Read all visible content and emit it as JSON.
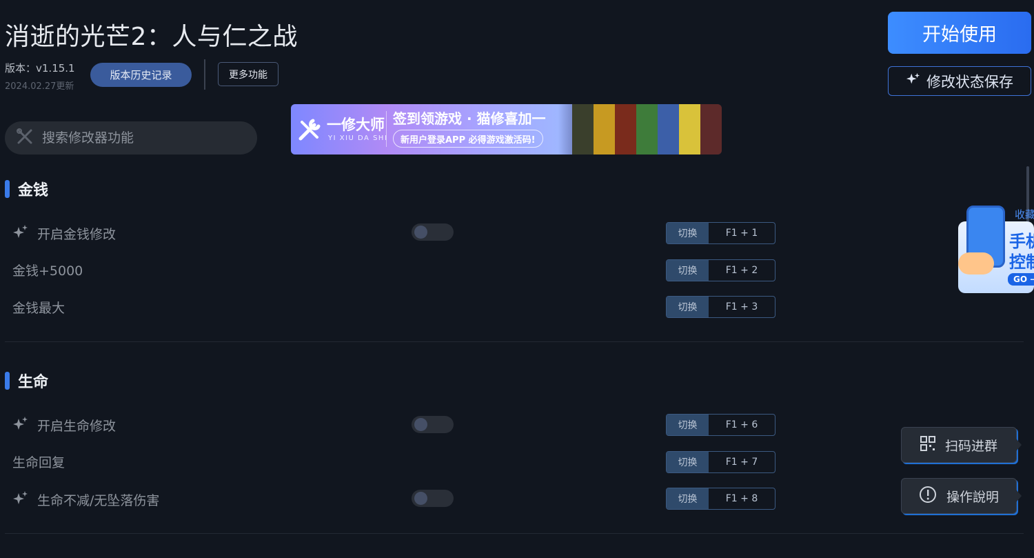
{
  "header": {
    "title": "消逝的光芒2：人与仁之战",
    "version": "版本：v1.15.1",
    "update_date": "2024.02.27更新",
    "history_button": "版本历史记录",
    "more_button": "更多功能"
  },
  "actions": {
    "start_button": "开始使用",
    "save_state_button": "修改状态保存"
  },
  "search": {
    "placeholder": "搜索修改器功能"
  },
  "banner": {
    "brand": "一修大师",
    "brand_pinyin": "YI XIU DA SHI",
    "headline": "签到领游戏 · 猫修喜加一",
    "subline": "新用户登录APP  必得游戏激活码!"
  },
  "sections": [
    {
      "title": "金钱",
      "rows": [
        {
          "label": "开启金钱修改",
          "has_toggle": true,
          "toggle_on": false,
          "action": "切换",
          "hotkey": "F1 + 1"
        },
        {
          "label": "金钱+5000",
          "has_toggle": false,
          "action": "切换",
          "hotkey": "F1 + 2"
        },
        {
          "label": "金钱最大",
          "has_toggle": false,
          "action": "切换",
          "hotkey": "F1 + 3"
        }
      ]
    },
    {
      "title": "生命",
      "rows": [
        {
          "label": "开启生命修改",
          "has_toggle": true,
          "toggle_on": false,
          "action": "切换",
          "hotkey": "F1 + 6"
        },
        {
          "label": "生命回复",
          "has_toggle": false,
          "action": "切换",
          "hotkey": "F1 + 7"
        },
        {
          "label": "生命不减/无坠落伤害",
          "has_toggle": true,
          "toggle_on": false,
          "action": "切换",
          "hotkey": "F1 + 8"
        }
      ]
    }
  ],
  "side_promo": {
    "top_text": "收藏",
    "line1": "手机",
    "line2": "控制",
    "go_label": "GO →"
  },
  "side_buttons": {
    "qr_group": "扫码进群",
    "instructions": "操作說明"
  },
  "colors": {
    "background": "#11161f",
    "accent": "#3a7bea",
    "primary_button": "#2a6cf0"
  }
}
